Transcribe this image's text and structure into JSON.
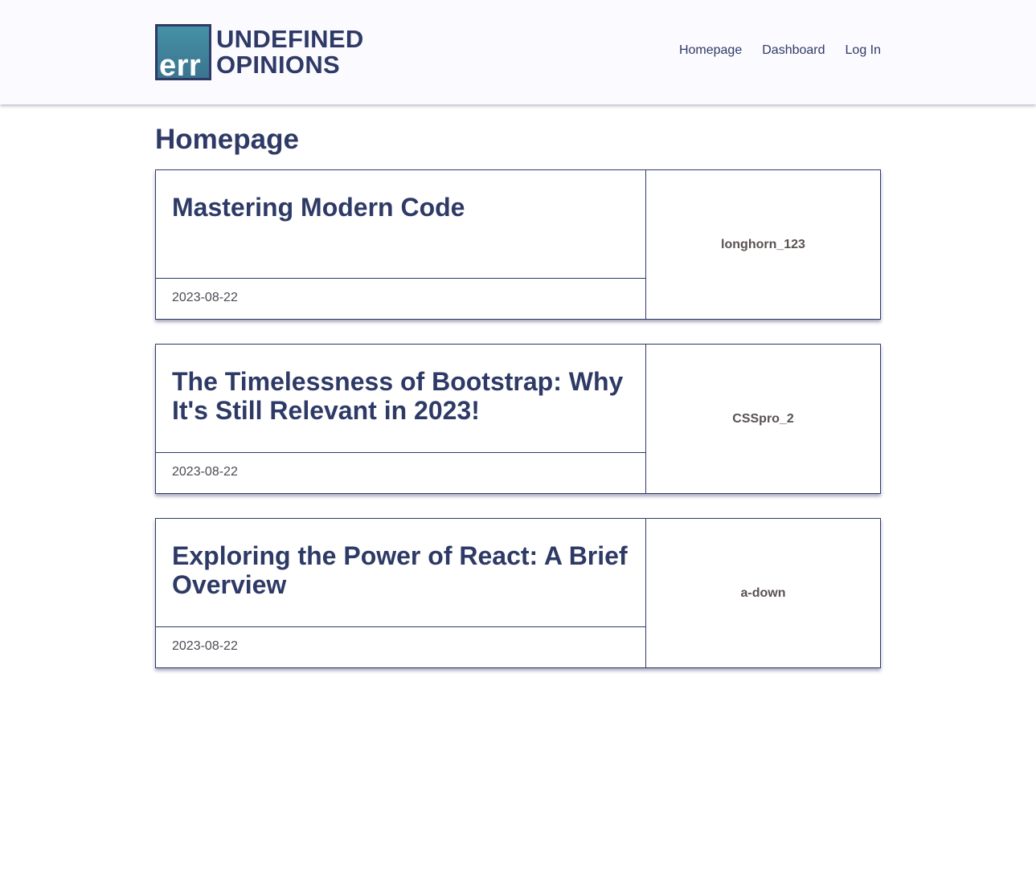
{
  "brand": {
    "logo_box_text": "err",
    "line1": "UNDEFINED",
    "line2": "OPINIONS"
  },
  "nav": {
    "homepage": "Homepage",
    "dashboard": "Dashboard",
    "login": "Log In"
  },
  "page": {
    "title": "Homepage"
  },
  "posts": [
    {
      "title": "Mastering Modern Code",
      "date": "2023-08-22",
      "author": "longhorn_123"
    },
    {
      "title": "The Timelessness of Bootstrap: Why It's Still Relevant in 2023!",
      "date": "2023-08-22",
      "author": "CSSpro_2"
    },
    {
      "title": "Exploring the Power of React: A Brief Overview",
      "date": "2023-08-22",
      "author": "a-down"
    }
  ],
  "colors": {
    "primary": "#2e3a66",
    "logo_teal": "#4591a6",
    "header_bg": "#fbfaff",
    "author_text": "#5a5050"
  }
}
